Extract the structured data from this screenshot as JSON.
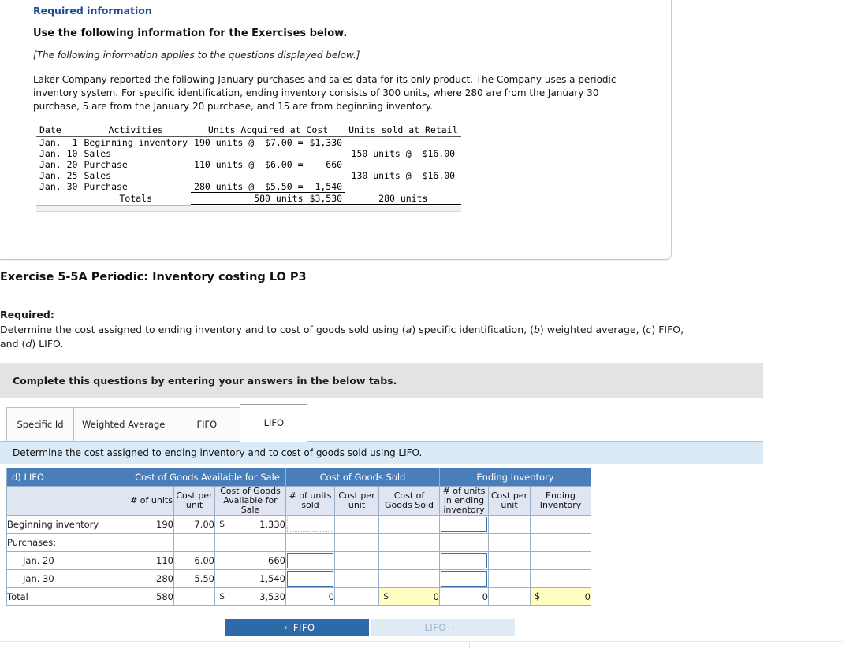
{
  "required_info": {
    "title": "Required information",
    "heading": "Use the following information for the Exercises below.",
    "italic_note": "[The following information applies to the questions displayed below.]",
    "paragraph": "Laker Company reported the following January purchases and sales data for its only product. The Company uses a periodic inventory system. For specific identification, ending inventory consists of 300 units, where 280 are from the January 30 purchase, 5 are from the January 20 purchase, and 15 are from beginning inventory.",
    "table": {
      "headers": [
        "Date",
        "Activities",
        "Units Acquired at Cost",
        "Units sold at Retail"
      ],
      "rows": [
        {
          "date": "Jan.  1",
          "activity": "Beginning inventory",
          "acquired": "190 units @  $7.00 =",
          "cost": "$1,330",
          "sold": ""
        },
        {
          "date": "Jan. 10",
          "activity": "Sales",
          "acquired": "",
          "cost": "",
          "sold": "150 units @  $16.00"
        },
        {
          "date": "Jan. 20",
          "activity": "Purchase",
          "acquired": "110 units @  $6.00 =",
          "cost": "660",
          "sold": ""
        },
        {
          "date": "Jan. 25",
          "activity": "Sales",
          "acquired": "",
          "cost": "",
          "sold": "130 units @  $16.00"
        },
        {
          "date": "Jan. 30",
          "activity": "Purchase",
          "acquired": "280 units @  $5.50 =",
          "cost": "1,540",
          "sold": ""
        },
        {
          "date": "",
          "activity": "Totals",
          "acquired": "580 units",
          "cost": "$3,530",
          "sold": "280 units"
        }
      ]
    }
  },
  "exercise": {
    "title": "Exercise 5-5A Periodic: Inventory costing LO P3",
    "required_label": "Required:",
    "required_text_1": "Determine the cost assigned to ending inventory and to cost of goods sold using (",
    "required_text_a": "a",
    "required_text_2": ") specific identification, (",
    "required_text_b": "b",
    "required_text_3": ") weighted average, (",
    "required_text_c": "c",
    "required_text_4": ") FIFO, and (",
    "required_text_d": "d",
    "required_text_5": ") LIFO."
  },
  "instruction_bar": "Complete this questions by entering your answers in the below tabs.",
  "tabs": [
    {
      "label": "Specific Id",
      "active": false
    },
    {
      "label": "Weighted Average",
      "active": false
    },
    {
      "label": "FIFO",
      "active": false
    },
    {
      "label": "LIFO",
      "active": true
    }
  ],
  "blue_strip": "Determine the cost assigned to ending inventory and to cost of goods sold using LIFO.",
  "grid": {
    "corner_label": "d) LIFO",
    "group_headers": [
      "Cost of Goods Available for Sale",
      "Cost of Goods Sold",
      "Ending Inventory"
    ],
    "sub_headers": [
      "# of units",
      "Cost per unit",
      "Cost of Goods Available for Sale",
      "# of units sold",
      "Cost per unit",
      "Cost of Goods Sold",
      "# of units in ending inventory",
      "Cost per unit",
      "Ending Inventory"
    ],
    "rows": [
      {
        "label": "Beginning inventory",
        "units": "190",
        "cost_per_unit": "7.00",
        "cogafs_dollar": "$",
        "cogafs": "1,330",
        "units_sold": "",
        "cogs_cost_per_unit": "",
        "cogs": "",
        "ei_units": "",
        "ei_cost_per_unit": "",
        "ei_total": ""
      },
      {
        "label": "Purchases:",
        "units": "",
        "cost_per_unit": "",
        "cogafs_dollar": "",
        "cogafs": "",
        "units_sold": "",
        "cogs_cost_per_unit": "",
        "cogs": "",
        "ei_units": "",
        "ei_cost_per_unit": "",
        "ei_total": ""
      },
      {
        "label": "Jan. 20",
        "units": "110",
        "cost_per_unit": "6.00",
        "cogafs_dollar": "",
        "cogafs": "660",
        "units_sold": "",
        "cogs_cost_per_unit": "",
        "cogs": "",
        "ei_units": "",
        "ei_cost_per_unit": "",
        "ei_total": ""
      },
      {
        "label": "Jan. 30",
        "units": "280",
        "cost_per_unit": "5.50",
        "cogafs_dollar": "",
        "cogafs": "1,540",
        "units_sold": "",
        "cogs_cost_per_unit": "",
        "cogs": "",
        "ei_units": "",
        "ei_cost_per_unit": "",
        "ei_total": ""
      },
      {
        "label": "Total",
        "units": "580",
        "cost_per_unit": "",
        "cogafs_dollar": "$",
        "cogafs": "3,530",
        "units_sold": "0",
        "cogs_cost_per_unit": "",
        "cogs_dollar": "$",
        "cogs": "0",
        "ei_units": "0",
        "ei_cost_per_unit": "",
        "ei_dollar": "$",
        "ei_total": "0"
      }
    ]
  },
  "nav": {
    "prev_label": "FIFO",
    "prev_chevron": "‹",
    "next_label": "LIFO",
    "next_chevron": "›"
  }
}
